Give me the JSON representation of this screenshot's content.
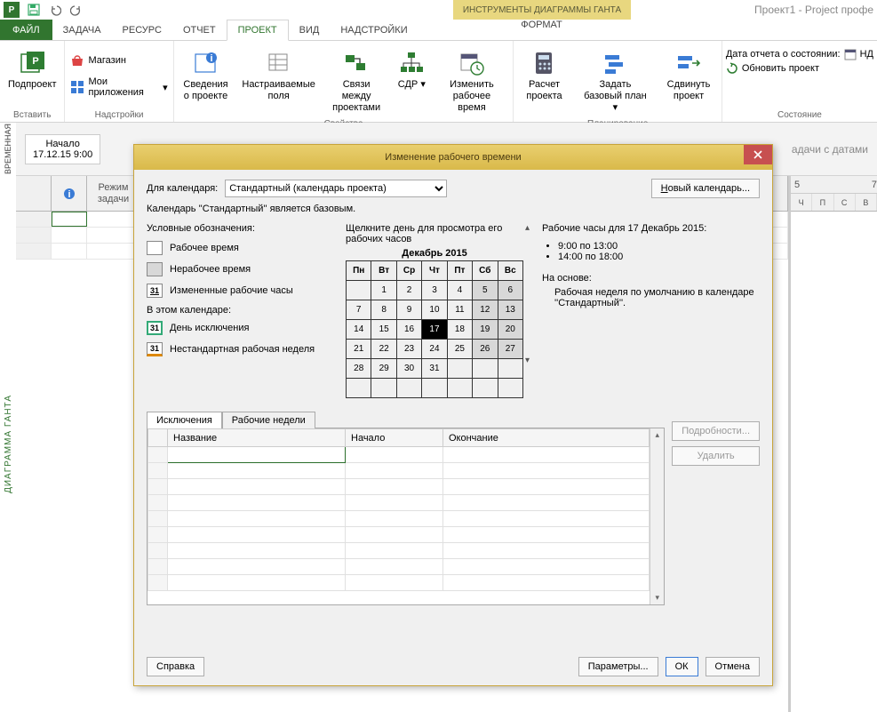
{
  "app": {
    "title": "Проект1 - Project профе"
  },
  "contextual": {
    "label": "ИНСТРУМЕНТЫ ДИАГРАММЫ ГАНТА",
    "tab": "ФОРМАТ"
  },
  "tabs": {
    "file": "ФАЙЛ",
    "task": "ЗАДАЧА",
    "resource": "РЕСУРС",
    "report": "ОТЧЕТ",
    "project": "ПРОЕКТ",
    "view": "ВИД",
    "addins": "НАДСТРОЙКИ"
  },
  "ribbon": {
    "insert": {
      "subproject": "Подпроект",
      "label": "Вставить"
    },
    "addins": {
      "store": "Магазин",
      "myapps": "Мои приложения",
      "label": "Надстройки"
    },
    "props": {
      "info": "Сведения о проекте",
      "custom": "Настраиваемые поля",
      "links": "Связи между проектами",
      "wbs": "СДР",
      "changewt": "Изменить рабочее время",
      "label": "Свойства"
    },
    "plan": {
      "calc": "Расчет проекта",
      "baseline": "Задать базовый план",
      "move": "Сдвинуть проект",
      "label": "Планирование"
    },
    "status": {
      "date_label": "Дата отчета о состоянии:",
      "date_value": "НД",
      "update": "Обновить проект",
      "label": "Состояние"
    }
  },
  "timeline": {
    "vert": "ВРЕМЕННАЯ",
    "start_label": "Начало",
    "start_value": "17.12.15 9:00",
    "hint": "адачи с датами"
  },
  "gantt": {
    "vert": "ДИАГРАММА ГАНТА",
    "col_mode_1": "Режим",
    "col_mode_2": "задачи",
    "week_num": "5",
    "7week": "7",
    "days": [
      "Ч",
      "П",
      "С",
      "В"
    ]
  },
  "dialog": {
    "title": "Изменение рабочего времени",
    "for_label": "Для календаря:",
    "for_value": "Стандартный (календарь проекта)",
    "new_cal": "Новый календарь...",
    "base_note": "Календарь ''Стандартный'' является базовым.",
    "legend": {
      "title": "Условные обозначения:",
      "work": "Рабочее время",
      "nonwork": "Нерабочее время",
      "changed": "Измененные рабочие часы",
      "in_this": "В этом календаре:",
      "exc_day": "День исключения",
      "nonstd": "Нестандартная рабочая неделя",
      "n31": "31"
    },
    "cal": {
      "hint": "Щелкните день для просмотра его рабочих часов",
      "month": "Декабрь 2015",
      "dow": [
        "Пн",
        "Вт",
        "Ср",
        "Чт",
        "Пт",
        "Сб",
        "Вс"
      ],
      "weeks": [
        [
          "",
          "1",
          "2",
          "3",
          "4",
          "5",
          "6"
        ],
        [
          "7",
          "8",
          "9",
          "10",
          "11",
          "12",
          "13"
        ],
        [
          "14",
          "15",
          "16",
          "17",
          "18",
          "19",
          "20"
        ],
        [
          "21",
          "22",
          "23",
          "24",
          "25",
          "26",
          "27"
        ],
        [
          "28",
          "29",
          "30",
          "31",
          "",
          "",
          ""
        ],
        [
          "",
          "",
          "",
          "",
          "",
          "",
          ""
        ]
      ],
      "selected": "17"
    },
    "hours": {
      "title": "Рабочие часы для 17 Декабрь 2015:",
      "slot1": "9:00 по 13:00",
      "slot2": "14:00 по 18:00",
      "based": "На основе:",
      "based_detail": "Рабочая неделя по умолчанию в календаре ''Стандартный''."
    },
    "inner_tabs": {
      "exc": "Исключения",
      "weeks": "Рабочие недели"
    },
    "exc_table": {
      "name": "Название",
      "start": "Начало",
      "end": "Окончание"
    },
    "side": {
      "details": "Подробности...",
      "delete": "Удалить"
    },
    "footer": {
      "help": "Справка",
      "options": "Параметры...",
      "ok": "ОК",
      "cancel": "Отмена"
    }
  }
}
